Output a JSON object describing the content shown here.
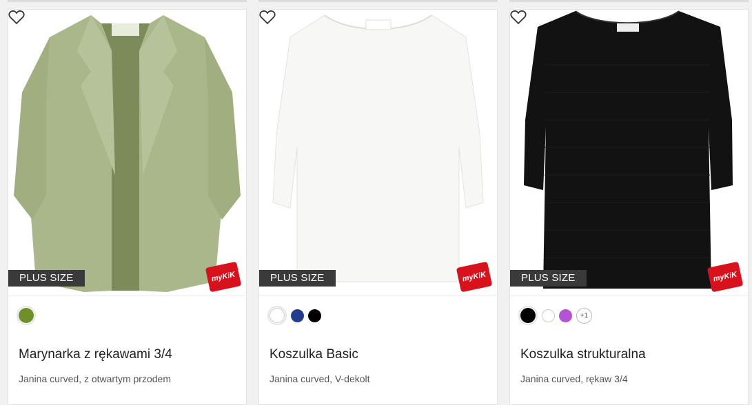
{
  "products": [
    {
      "name": "Marynarka z rękawami 3/4",
      "description": "Janina curved, z otwartym przodem",
      "badge": "PLUS SIZE",
      "logo": "myKiK",
      "colors": [
        "#6f8f2a"
      ],
      "more_colors": ""
    },
    {
      "name": "Koszulka Basic",
      "description": "Janina curved, V-dekolt",
      "badge": "PLUS SIZE",
      "logo": "myKiK",
      "colors": [
        "#ffffff",
        "#243c8c",
        "#000000"
      ],
      "more_colors": ""
    },
    {
      "name": "Koszulka strukturalna",
      "description": "Janina curved, rękaw 3/4",
      "badge": "PLUS SIZE",
      "logo": "myKiK",
      "colors": [
        "#000000",
        "#ffffff",
        "#b552d6"
      ],
      "more_colors": "+1"
    }
  ],
  "icons": {
    "favorite": "heart-outline-icon"
  }
}
